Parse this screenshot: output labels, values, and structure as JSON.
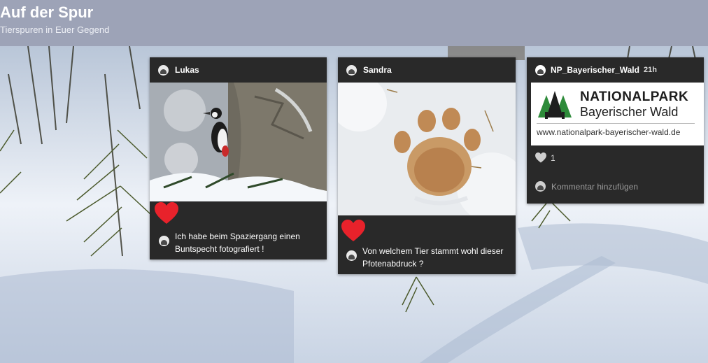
{
  "header": {
    "title": "Auf der Spur",
    "subtitle": "Tierspuren in Euer Gegend"
  },
  "posts": [
    {
      "author": "Lukas",
      "image": "woodpecker-photo",
      "liked": true,
      "caption": "Ich habe beim Spaziergang einen Buntspecht fotografiert !"
    },
    {
      "author": "Sandra",
      "image": "pawprint-in-snow-photo",
      "liked": true,
      "caption": "Von welchem Tier stammt wohl dieser Pfotenabdruck ?"
    },
    {
      "author": "NP_Bayerischer_Wald",
      "time": "21h",
      "logo": {
        "line1": "NATIONALPARK",
        "line2": "Bayerischer Wald",
        "url": "www.nationalpark-bayerischer-wald.de"
      },
      "likes": "1",
      "comment_placeholder": "Kommentar hinzufügen"
    }
  ],
  "colors": {
    "header_bg": "#9da3b7",
    "card_bg": "#292929",
    "heart": "#e8222b",
    "logo_green": "#2e8b3a"
  }
}
